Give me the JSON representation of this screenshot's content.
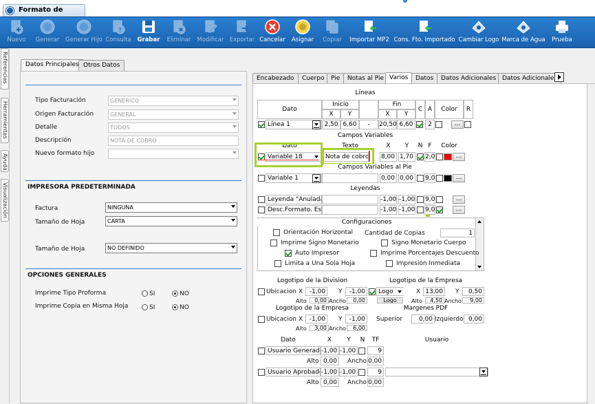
{
  "window": {
    "title": "Formato de Factura"
  },
  "toolbar": [
    {
      "label": "Nuevo",
      "icon": "plus-circle-icon",
      "enabled": false
    },
    {
      "label": "Generar",
      "icon": "globe-icon",
      "enabled": false
    },
    {
      "label": "Generar Hijo",
      "icon": "globe-child-icon",
      "enabled": false
    },
    {
      "label": "Consulta",
      "icon": "help-document-icon",
      "enabled": false
    },
    {
      "label": "Grabar",
      "icon": "floppy-icon",
      "enabled": true
    },
    {
      "label": "Eliminar",
      "icon": "delete-document-icon",
      "enabled": false
    },
    {
      "label": "Modificar",
      "icon": "edit-document-icon",
      "enabled": false
    },
    {
      "label": "Exportar",
      "icon": "export-document-icon",
      "enabled": false
    },
    {
      "label": "Cancelar",
      "icon": "cancel-icon",
      "enabled": true
    },
    {
      "label": "Asignar",
      "icon": "assign-icon",
      "enabled": true
    },
    {
      "label": "Copiar",
      "icon": "copy-icon",
      "enabled": false
    },
    {
      "label": "Importar MP2",
      "icon": "import-document-icon",
      "enabled": true
    },
    {
      "label": "Cons. Fto. Importado",
      "icon": "import-query-icon",
      "enabled": true
    },
    {
      "label": "Cambiar Logo",
      "icon": "logo-icon",
      "enabled": true
    },
    {
      "label": "Marca de Agua",
      "icon": "watermark-icon",
      "enabled": true
    },
    {
      "label": "Prueba",
      "icon": "printer-icon",
      "enabled": true
    }
  ],
  "side_tabs": [
    "Referencias",
    "Herramientas",
    "Ayuda",
    "Visualización"
  ],
  "left_tabs": [
    "Datos Principales",
    "Otros Datos"
  ],
  "general": {
    "tipo_facturacion": {
      "label": "Tipo Facturación",
      "value": "GENERICO"
    },
    "origen_facturacion": {
      "label": "Origen Facturación",
      "value": "GENERAL"
    },
    "detalle": {
      "label": "Detalle",
      "value": "TODOS"
    },
    "descripcion": {
      "label": "Descripción",
      "value": "NOTA DE COBRO"
    },
    "nuevo_formato_hijo": {
      "label": "Nuevo formato hijo",
      "value": ""
    }
  },
  "impresora": {
    "title": "IMPRESORA PREDETERMINADA",
    "factura": {
      "label": "Factura",
      "value": "NINGUNA"
    },
    "tamano_hoja": {
      "label": "Tamaño de Hoja",
      "value": "CARTA"
    },
    "tamano_hoja2": {
      "label": "Tamaño de Hoja",
      "value": "NO DEFINIDO"
    }
  },
  "opciones": {
    "title": "OPCIONES GENERALES",
    "proforma": {
      "label": "Imprime Tipo Proforma",
      "si": "SI",
      "no": "NO",
      "selected": "NO"
    },
    "copia": {
      "label": "Imprime Copia en Misma Hoja",
      "si": "SI",
      "no": "NO",
      "selected": "NO"
    }
  },
  "right_tabs": [
    "Encabezado",
    "Cuerpo",
    "Pie",
    "Notas al Pie",
    "Varios",
    "Datos",
    "Datos Adicionales",
    "Datos Adicionales"
  ],
  "lineas": {
    "title": "Líneas",
    "headers": {
      "dato": "Dato",
      "inicio": "Inicio",
      "fin": "Fin",
      "x": "X",
      "y": "Y",
      "c": "C",
      "a": "A",
      "color": "Color",
      "r": "R"
    },
    "row": {
      "dato": "Línea 1",
      "x1": "2,50",
      "y1": "6,60",
      "dash": "-",
      "x2": "20,50",
      "y2": "6,60",
      "a": "2"
    }
  },
  "campos": {
    "title": "Campos Variables",
    "headers": {
      "dato": "Dato",
      "texto": "Texto",
      "x": "X",
      "y": "Y",
      "n": "N",
      "f": "F",
      "color": "Color"
    },
    "row": {
      "dato": "Variable 18",
      "texto": "Nota de cobro",
      "x": "8,00",
      "y": "1,70",
      "f": "2,0",
      "color": "#ff0000"
    }
  },
  "campos_pie": {
    "title": "Campos Variables al Pie",
    "row": {
      "dato": "Variable 1",
      "x": "0,00",
      "y": "0,00",
      "f": "9,0",
      "color": "#000000"
    }
  },
  "leyendas": {
    "title": "Leyendas",
    "rows": [
      {
        "dato": "Leyenda \"Anulada\"",
        "x": "-1,00",
        "y": "-1,00",
        "f": "9,0"
      },
      {
        "dato": "Desc.Formato. Esp.",
        "x": "-1,00",
        "y": "-1,00",
        "f": "9,0"
      }
    ]
  },
  "config": {
    "title": "Configuraciones",
    "orientacion": "Orientación Horizontal",
    "cantidad_copias": "Cantidad de Copias",
    "copias_value": "1",
    "signo": "Imprime Signo Monetario",
    "signo_cuerpo": "Signo Monetario Cuerpo",
    "auto": "Auto Impresor",
    "porcentajes": "Imprime Porcentajes Descuento",
    "limita": "Limita a Una Sola Hoja",
    "inmediata": "Impresión Inmediata"
  },
  "logos": {
    "division_title": "Logotipo de la Division",
    "empresa_title": "Logotipo de la Empresa",
    "ubicacion": "Ubicacion",
    "x": "X",
    "y": "Y",
    "alto": "Alto",
    "ancho": "Ancho",
    "div_x": "-1,00",
    "div_y": "-1,00",
    "div_alto": "0,00",
    "div_ancho": "0,00",
    "emp_logo": "Logo 1",
    "emp_x": "13,00",
    "emp_y": "0,50",
    "emp_logo_btn": "Logo",
    "emp_alto": "4,50",
    "emp_ancho": "9,00",
    "empresa2_title": "Logotipo de la Empresa",
    "emp2_x": "-1,00",
    "emp2_y": "-1,00",
    "emp2_alto": "3,00",
    "emp2_ancho": "6,00",
    "margenes_title": "Margenes PDF",
    "superior": "Superior",
    "superior_val": "0,00",
    "izquierdo": "Izquierdo",
    "izquierdo_val": "0,00"
  },
  "usuarios": {
    "headers": {
      "dato": "Dato",
      "x": "X",
      "y": "Y",
      "n": "N",
      "tf": "TF",
      "usuario": "Usuario"
    },
    "rows": [
      {
        "dato": "Usuario Generador",
        "x": "-1,00",
        "y": "-1,00",
        "tf": "9",
        "alto": "0,00",
        "ancho": "0,00"
      },
      {
        "dato": "Usuario Aprobador",
        "x": "-1,00",
        "y": "-1,00",
        "tf": "9",
        "alto": "0,00",
        "ancho": "0,00"
      }
    ],
    "alto_label": "Alto",
    "ancho_label": "Ancho"
  },
  "colors": {
    "toolbar": "#1f6fc2",
    "accent": "#a6d02f",
    "section_line": "#3a7ac8"
  }
}
